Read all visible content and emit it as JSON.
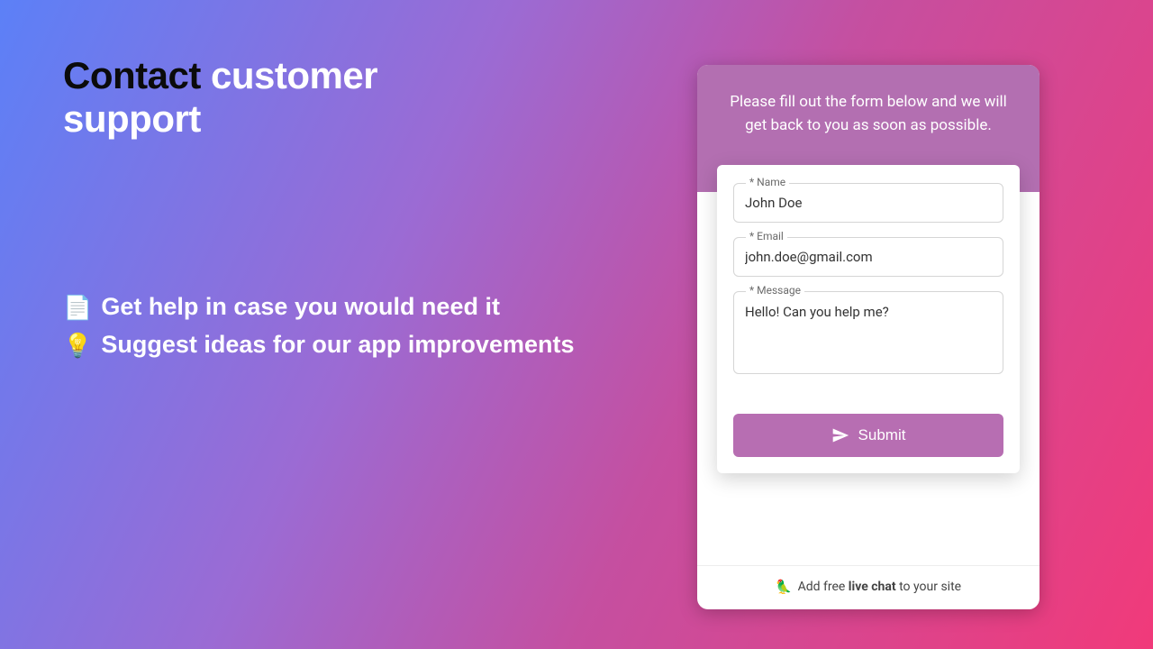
{
  "hero": {
    "title_dark": "Contact",
    "title_light": "customer support"
  },
  "bullets": [
    {
      "emoji": "📄",
      "text": "Get help in case you would need it"
    },
    {
      "emoji": "💡",
      "text": "Suggest ideas for our app improvements"
    }
  ],
  "card": {
    "header": "Please fill out the form below and we will get back to you as soon as possible.",
    "fields": {
      "name": {
        "label": "* Name",
        "value": "John Doe"
      },
      "email": {
        "label": "* Email",
        "value": "john.doe@gmail.com"
      },
      "message": {
        "label": "* Message",
        "value": "Hello! Can you help me?"
      }
    },
    "submit_label": "Submit",
    "footer": {
      "emoji": "🦜",
      "prefix": "Add free ",
      "bold": "live chat",
      "suffix": " to your site"
    }
  }
}
